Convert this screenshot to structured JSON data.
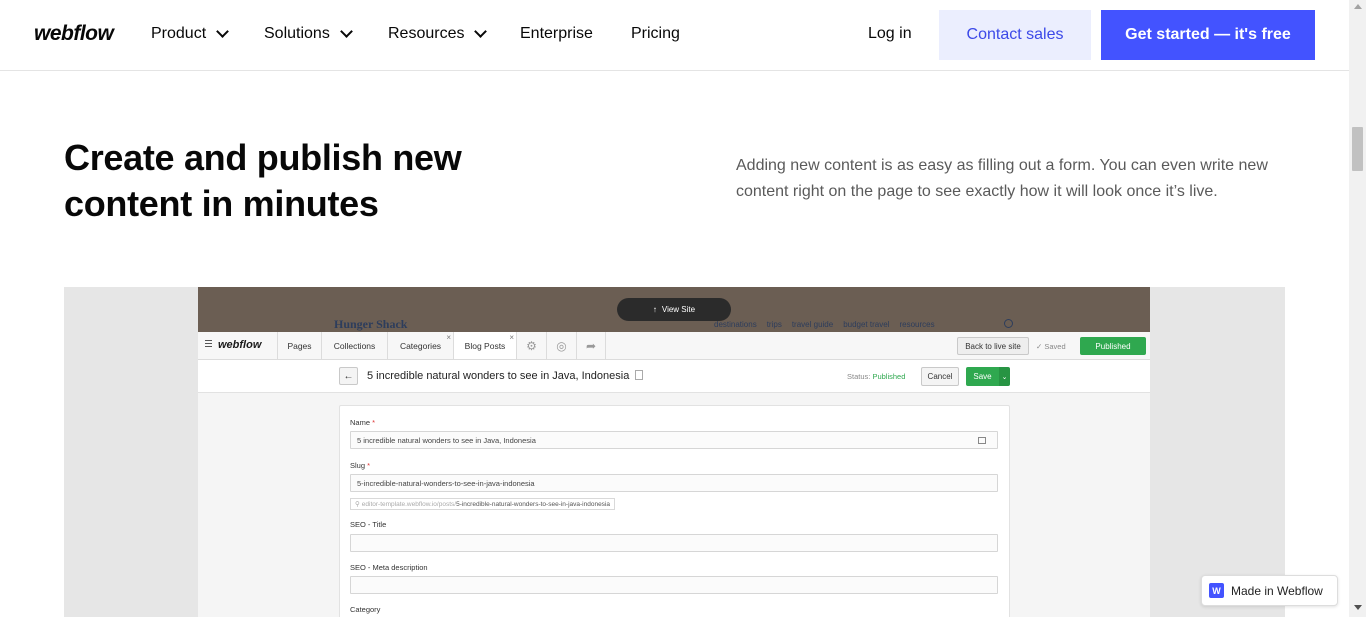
{
  "nav": {
    "logo": "webflow",
    "items": [
      {
        "label": "Product",
        "has_dropdown": true
      },
      {
        "label": "Solutions",
        "has_dropdown": true
      },
      {
        "label": "Resources",
        "has_dropdown": true
      },
      {
        "label": "Enterprise",
        "has_dropdown": false
      },
      {
        "label": "Pricing",
        "has_dropdown": false
      }
    ],
    "login": "Log in",
    "contact_sales": "Contact sales",
    "get_started": "Get started — it's free"
  },
  "hero": {
    "title": "Create and publish new content in minutes",
    "description": "Adding new content is as easy as filling out a form. You can even write new content right on the page to see exactly how it will look once it’s live."
  },
  "mock": {
    "site_logo": "Hunger Shack",
    "site_links": [
      "destinations",
      "trips",
      "travel guide",
      "budget travel",
      "resources"
    ],
    "view_site": "View Site",
    "toolbar": {
      "logo": "webflow",
      "tabs": [
        "Pages",
        "Collections",
        "Categories",
        "Blog Posts"
      ],
      "back_to_live": "Back to live site",
      "saved": "✓ Saved",
      "published": "Published"
    },
    "editor": {
      "title": "5 incredible natural wonders to see in Java, Indonesia",
      "status_label": "Status:",
      "status_value": "Published",
      "cancel": "Cancel",
      "save": "Save"
    },
    "form": {
      "name_label": "Name",
      "name_value": "5 incredible natural wonders to see in Java, Indonesia",
      "slug_label": "Slug",
      "slug_value": "5-incredible-natural-wonders-to-see-in-java-indonesia",
      "url_prefix": "editor-template.webflow.io/posts/",
      "url_slug": "5-incredible-natural-wonders-to-see-in-java-indonesia",
      "seo_title_label": "SEO - Title",
      "seo_meta_label": "SEO - Meta description",
      "category_label": "Category",
      "required_mark": "*"
    }
  },
  "badge": {
    "icon_letter": "W",
    "label": "Made in Webflow"
  },
  "colors": {
    "brand_blue": "#4353ff",
    "contact_bg": "#ebeefe",
    "published_green": "#2fa84f"
  }
}
